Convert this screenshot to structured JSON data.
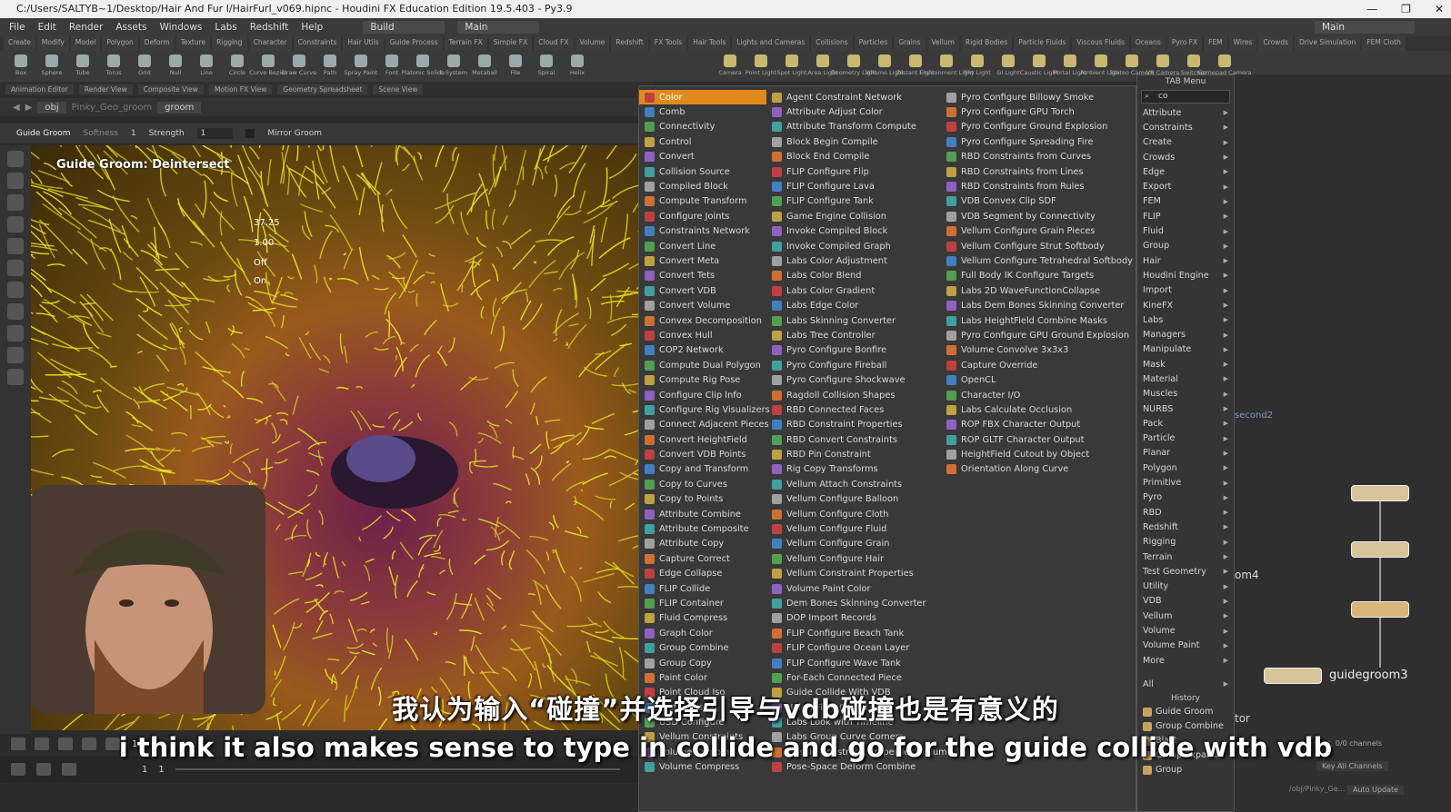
{
  "window": {
    "title": "C:/Users/SALTYB~1/Desktop/Hair And Fur I/HairFurI_v069.hipnc - Houdini FX Education Edition 19.5.403 - Py3.9",
    "controls": [
      "—",
      "❐",
      "✕"
    ]
  },
  "menubar": {
    "items": [
      "File",
      "Edit",
      "Render",
      "Assets",
      "Windows",
      "Labs",
      "Redshift",
      "Help"
    ],
    "desktop1": "Build",
    "desktop2": "Main",
    "desktop3": "Main"
  },
  "shelf_tabs": [
    "Create",
    "Modify",
    "Model",
    "Polygon",
    "Deform",
    "Texture",
    "Rigging",
    "Character",
    "Constraints",
    "Hair Utils",
    "Guide Process",
    "Terrain FX",
    "Simple FX",
    "Cloud FX",
    "Volume",
    "Redshift",
    "FX Tools",
    "Hair Tools",
    "Lights and Cameras",
    "Collisions",
    "Particles",
    "Grains",
    "Vellum",
    "Rigid Bodies",
    "Particle Fluids",
    "Viscous Fluids",
    "Oceans",
    "Pyro FX",
    "FEM",
    "Wires",
    "Crowds",
    "Drive Simulation",
    "FEM Cloth"
  ],
  "shelf_tools": [
    "Box",
    "Sphere",
    "Tube",
    "Torus",
    "Grid",
    "Null",
    "Line",
    "Circle",
    "Curve Bezier",
    "Draw Curve",
    "Path",
    "Spray Paint",
    "Font",
    "Platonic Solids",
    "L-System",
    "Metaball",
    "File",
    "Spiral",
    "Helix"
  ],
  "light_tools": [
    "Camera",
    "Point Light",
    "Spot Light",
    "Area Light",
    "Geometry Light",
    "Volume Light",
    "Distant Light",
    "Environment Light",
    "Sky Light",
    "GI Light",
    "Caustic Light",
    "Portal Light",
    "Ambient Light",
    "Stereo Camera",
    "VR Camera",
    "Switcher",
    "Gamepad Camera"
  ],
  "pane_tabs": [
    "Animation Editor",
    "Render View",
    "Composite View",
    "Motion FX View",
    "Geometry Spreadsheet",
    "Scene View"
  ],
  "path": {
    "obj": "obj",
    "node": "Pinky_Geo_groom",
    "groom": "groom"
  },
  "tool_options": {
    "tool": "Guide Groom",
    "mode": "Softness",
    "mode_value": "1",
    "strength_label": "Strength",
    "strength_value": "1",
    "mirror_label": "Mirror Groom"
  },
  "viewport": {
    "title": "Guide Groom: Deintersect",
    "hud_values": [
      "37.25",
      "1.00",
      "Off",
      "On"
    ]
  },
  "timeline": {
    "frame": "1",
    "start": "1",
    "end": "1"
  },
  "tab_menu": {
    "col1": [
      "Color",
      "Comb",
      "Connectivity",
      "Control",
      "Convert",
      "Collision Source",
      "Compiled Block",
      "Compute Transform",
      "Configure Joints",
      "Constraints Network",
      "Convert Line",
      "Convert Meta",
      "Convert Tets",
      "Convert VDB",
      "Convert Volume",
      "Convex Decomposition",
      "Convex Hull",
      "COP2 Network",
      "Compute Dual Polygon",
      "Compute Rig Pose",
      "Configure Clip Info",
      "Configure Rig Visualizers",
      "Connect Adjacent Pieces",
      "Convert HeightField",
      "Convert VDB Points",
      "Copy and Transform",
      "Copy to Curves",
      "Copy to Points",
      "Attribute Combine",
      "Attribute Composite",
      "Attribute Copy",
      "Capture Correct",
      "Edge Collapse",
      "FLIP Collide",
      "FLIP Container",
      "Fluid Compress",
      "Graph Color",
      "Group Combine",
      "Group Copy",
      "Paint Color",
      "Point Cloud Iso",
      "Test Collision",
      "USD Configure",
      "Vellum Constraints",
      "Volume Combine",
      "Volume Compress"
    ],
    "col2": [
      "Agent Constraint Network",
      "Attribute Adjust Color",
      "Attribute Transform Compute",
      "Block Begin Compile",
      "Block End Compile",
      "FLIP Configure Flip",
      "FLIP Configure Lava",
      "FLIP Configure Tank",
      "Game Engine Collision",
      "Invoke Compiled Block",
      "Invoke Compiled Graph",
      "Labs Color Adjustment",
      "Labs Color Blend",
      "Labs Color Gradient",
      "Labs Edge Color",
      "Labs Skinning Converter",
      "Labs Tree Controller",
      "Pyro Configure Bonfire",
      "Pyro Configure Fireball",
      "Pyro Configure Shockwave",
      "Ragdoll Collision Shapes",
      "RBD Connected Faces",
      "RBD Constraint Properties",
      "RBD Convert Constraints",
      "RBD Pin Constraint",
      "Rig Copy Transforms",
      "Vellum Attach Constraints",
      "Vellum Configure Balloon",
      "Vellum Configure Cloth",
      "Vellum Configure Fluid",
      "Vellum Configure Grain",
      "Vellum Configure Hair",
      "Vellum Constraint Properties",
      "Volume Paint Color",
      "Dem Bones Skinning Converter",
      "DOP Import Records",
      "FLIP Configure Beach Tank",
      "FLIP Configure Ocean Layer",
      "FLIP Configure Wave Tank",
      "For-Each Connected Piece",
      "Guide Collide With VDB",
      "HeightField Copy Layer",
      "Labs Look with Timeline",
      "Labs Group Curve Corners",
      "Muscle Constraint Properties Vellum",
      "Pose-Space Deform Combine"
    ],
    "col3": [
      "Pyro Configure Billowy Smoke",
      "Pyro Configure GPU Torch",
      "Pyro Configure Ground Explosion",
      "Pyro Configure Spreading Fire",
      "RBD Constraints from Curves",
      "RBD Constraints from Lines",
      "RBD Constraints from Rules",
      "VDB Convex Clip SDF",
      "VDB Segment by Connectivity",
      "Vellum Configure Grain Pieces",
      "Vellum Configure Strut Softbody",
      "Vellum Configure Tetrahedral Softbody",
      "Full Body IK Configure Targets",
      "Labs 2D WaveFunctionCollapse",
      "Labs Dem Bones Skinning Converter",
      "Labs HeightField Combine Masks",
      "Pyro Configure GPU Ground Explosion",
      "Volume Convolve 3x3x3",
      "Capture Override",
      "OpenCL",
      "Character I/O",
      "Labs Calculate Occlusion",
      "ROP FBX Character Output",
      "ROP GLTF Character Output",
      "HeightField Cutout by Object",
      "Orientation Along Curve"
    ]
  },
  "categories": {
    "header": "TAB Menu",
    "search": "co",
    "items": [
      "Attribute",
      "Constraints",
      "Create",
      "Crowds",
      "Edge",
      "Export",
      "FEM",
      "FLIP",
      "Fluid",
      "Group",
      "Hair",
      "Houdini Engine",
      "Import",
      "KineFX",
      "Labs",
      "Managers",
      "Manipulate",
      "Mask",
      "Material",
      "Muscles",
      "NURBS",
      "Pack",
      "Particle",
      "Planar",
      "Polygon",
      "Primitive",
      "Pyro",
      "RBD",
      "Redshift",
      "Rigging",
      "Terrain",
      "Test Geometry",
      "Utility",
      "VDB",
      "Vellum",
      "Volume",
      "Volume Paint",
      "More"
    ],
    "all": "All",
    "history_label": "History",
    "history": [
      "Guide Groom",
      "Group Combine",
      "Blast",
      "Group Expand",
      "Group"
    ]
  },
  "network": {
    "label1": "second2",
    "label2": "om4",
    "node": "guidegroom3",
    "bottom": "tor",
    "keys": "0 keys, 0/0 channels",
    "key_all": "Key All Channels",
    "auto_update": "Auto Update",
    "path": "/obj/Pinky_Ge..."
  },
  "subtitles": {
    "cn": "我认为输入“碰撞”并选择引导与vdb碰撞也是有意义的",
    "en": "i think it also makes sense to type in collide and go for the guide collide with vdb"
  },
  "colors": {
    "selected": "#e08a1e",
    "hair": "#e6e020",
    "node": "#d8c49a"
  }
}
